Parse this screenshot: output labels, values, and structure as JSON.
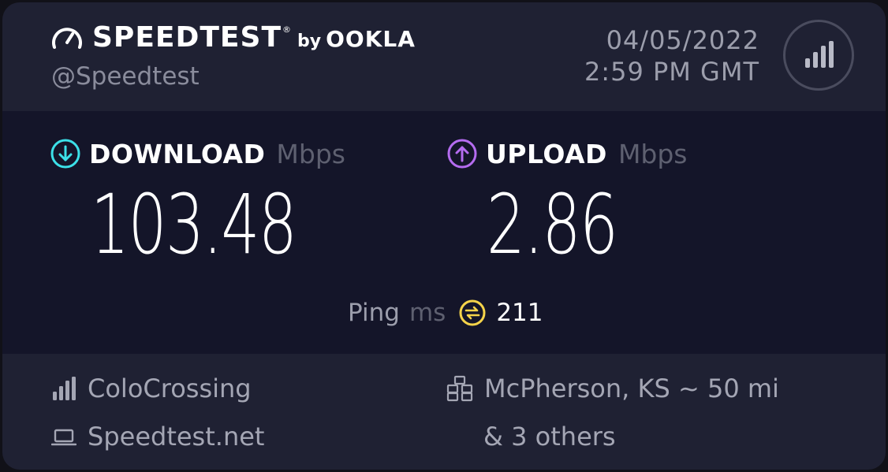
{
  "header": {
    "brand_name": "SPEEDTEST",
    "brand_tm": "®",
    "by": "by",
    "company": "OOKLA",
    "handle": "@Speedtest",
    "date": "04/05/2022",
    "time": "2:59 PM GMT",
    "results_icon": "results-bars-icon"
  },
  "download": {
    "label": "DOWNLOAD",
    "unit": "Mbps",
    "value": "103.48",
    "icon": "arrow-down-circle-icon",
    "color": "#3ce0e8"
  },
  "upload": {
    "label": "UPLOAD",
    "unit": "Mbps",
    "value": "2.86",
    "icon": "arrow-up-circle-icon",
    "color": "#b56cf0"
  },
  "ping": {
    "label": "Ping",
    "unit": "ms",
    "value": "211",
    "icon": "ping-icon",
    "color": "#f5d34a"
  },
  "footer": {
    "isp": "ColoCrossing",
    "site": "Speedtest.net",
    "server": "McPherson, KS ~ 50 mi",
    "others": "& 3 others"
  }
}
